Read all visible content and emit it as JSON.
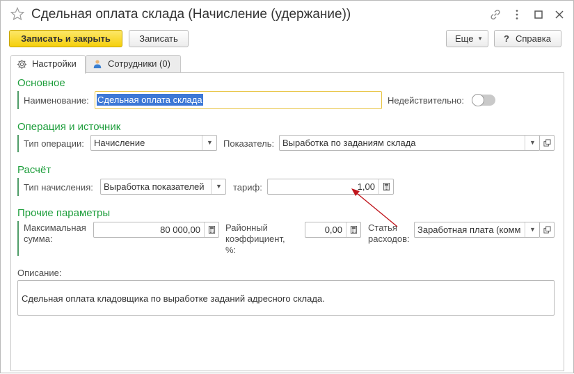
{
  "window": {
    "title": "Сдельная оплата склада (Начисление (удержание))",
    "icons": [
      "star-icon",
      "link-icon",
      "more-icon",
      "maximize-icon",
      "close-icon"
    ]
  },
  "toolbar": {
    "save_close_label": "Записать и закрыть",
    "save_label": "Записать",
    "more_label": "Еще",
    "help_label": "Справка"
  },
  "tabs": [
    {
      "label": "Настройки",
      "icon": "gear-icon",
      "active": true
    },
    {
      "label": "Сотрудники (0)",
      "icon": "person-icon",
      "active": false
    }
  ],
  "sections": {
    "main": {
      "title": "Основное",
      "name_label": "Наименование:",
      "name_value": "Сдельная оплата склада",
      "inactive_label": "Недействительно:",
      "inactive_on": false
    },
    "operation": {
      "title": "Операция и источник",
      "op_type_label": "Тип операции:",
      "op_type_value": "Начисление",
      "indicator_label": "Показатель:",
      "indicator_value": "Выработка по заданиям склада"
    },
    "calc": {
      "title": "Расчёт",
      "calc_type_label": "Тип начисления:",
      "calc_type_value": "Выработка показателей",
      "rate_label": "тариф:",
      "rate_value": "1,00"
    },
    "other": {
      "title": "Прочие параметры",
      "max_sum_label_1": "Максимальная",
      "max_sum_label_2": "сумма:",
      "max_sum_value": "80 000,00",
      "regional_label_1": "Районный",
      "regional_label_2": "коэффициент,",
      "regional_label_3": "%:",
      "regional_value": "0,00",
      "expense_label_1": "Статья",
      "expense_label_2": "расходов:",
      "expense_value": "Заработная плата (комм"
    },
    "description": {
      "label": "Описание:",
      "value": "Сдельная оплата кладовщика по выработке заданий адресного склада."
    }
  },
  "colors": {
    "accent_green": "#1e9e3c",
    "primary_button": "#f5cf0c",
    "annotation_arrow": "#c0161d"
  }
}
